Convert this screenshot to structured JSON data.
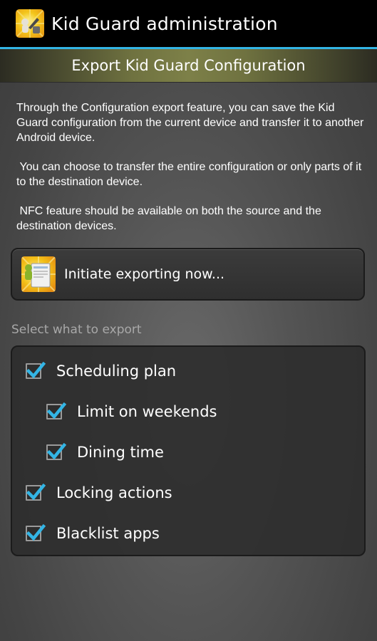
{
  "action_bar": {
    "title": "Kid Guard administration",
    "icon": "kid-guard-app-icon"
  },
  "banner": {
    "title": "Export Kid Guard Configuration"
  },
  "description": {
    "paragraphs": [
      "Through the Configuration export feature, you can save the Kid Guard configuration from the current device and transfer it to another Android device.",
      " You can choose to transfer the entire configuration or only parts of it to the destination device.",
      " NFC feature should be available on both the source and the destination devices."
    ]
  },
  "export_button": {
    "label": "Initiate exporting now...",
    "icon": "export-icon"
  },
  "options_section": {
    "label": "Select what to export",
    "items": [
      {
        "label": "Scheduling plan",
        "checked": true,
        "level": 0
      },
      {
        "label": "Limit on weekends",
        "checked": true,
        "level": 1
      },
      {
        "label": "Dining time",
        "checked": true,
        "level": 1
      },
      {
        "label": "Locking actions",
        "checked": true,
        "level": 0
      },
      {
        "label": "Blacklist apps",
        "checked": true,
        "level": 0
      }
    ]
  },
  "colors": {
    "accent": "#33b5e5",
    "checkmark": "#33b5e5",
    "banner": "#7d8048"
  }
}
